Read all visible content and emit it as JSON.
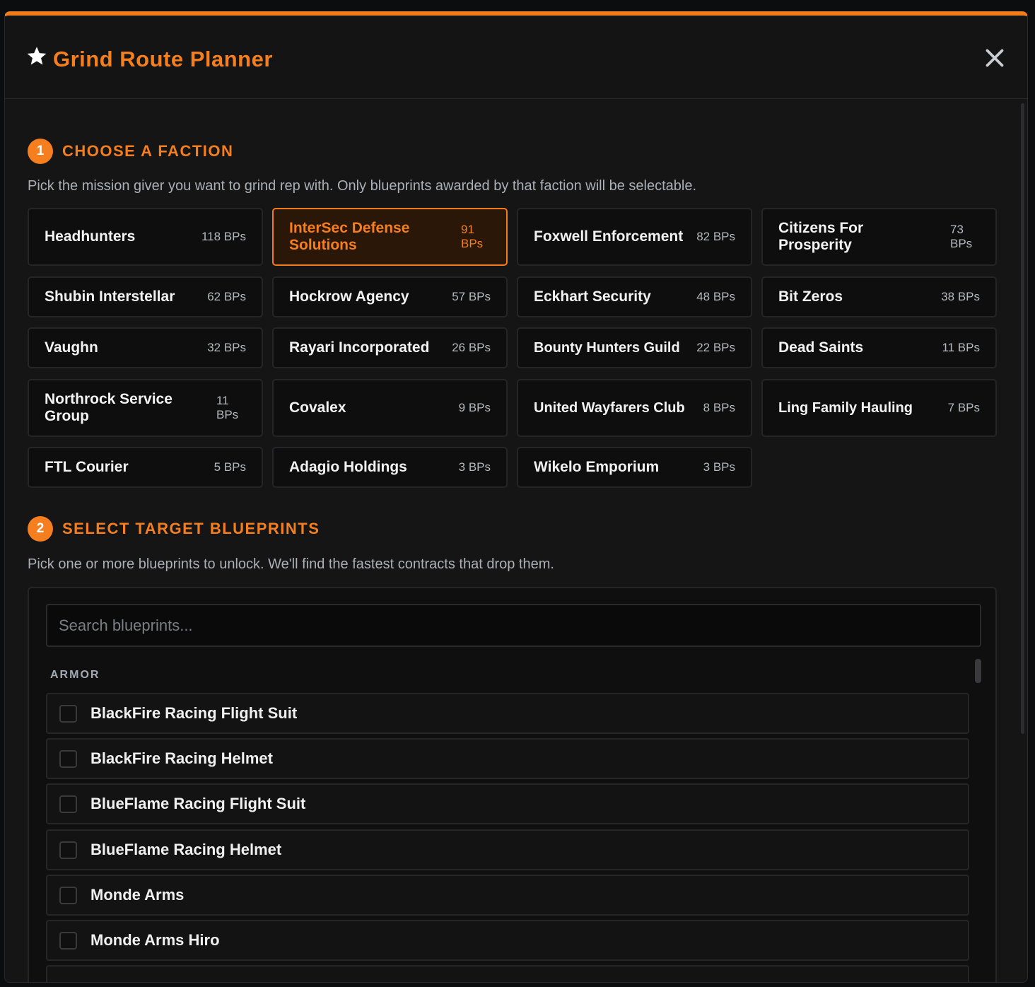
{
  "modal": {
    "title": "Grind Route Planner",
    "accent_color": "#f57f1f",
    "title_icon": "star-icon",
    "close_icon": "close-icon"
  },
  "step1": {
    "number": "1",
    "title": "CHOOSE A FACTION",
    "description": "Pick the mission giver you want to grind rep with. Only blueprints awarded by that faction will be selectable."
  },
  "factions": [
    {
      "name": "Headhunters",
      "count": "118 BPs",
      "selected": false
    },
    {
      "name": "InterSec Defense Solutions",
      "count": "91 BPs",
      "selected": true
    },
    {
      "name": "Foxwell Enforcement",
      "count": "82 BPs",
      "selected": false
    },
    {
      "name": "Citizens For Prosperity",
      "count": "73 BPs",
      "selected": false
    },
    {
      "name": "Shubin Interstellar",
      "count": "62 BPs",
      "selected": false
    },
    {
      "name": "Hockrow Agency",
      "count": "57 BPs",
      "selected": false
    },
    {
      "name": "Eckhart Security",
      "count": "48 BPs",
      "selected": false
    },
    {
      "name": "Bit Zeros",
      "count": "38 BPs",
      "selected": false
    },
    {
      "name": "Vaughn",
      "count": "32 BPs",
      "selected": false
    },
    {
      "name": "Rayari Incorporated",
      "count": "26 BPs",
      "selected": false
    },
    {
      "name": "Bounty Hunters Guild",
      "count": "22 BPs",
      "selected": false
    },
    {
      "name": "Dead Saints",
      "count": "11 BPs",
      "selected": false
    },
    {
      "name": "Northrock Service Group",
      "count": "11 BPs",
      "selected": false
    },
    {
      "name": "Covalex",
      "count": "9 BPs",
      "selected": false
    },
    {
      "name": "United Wayfarers Club",
      "count": "8 BPs",
      "selected": false
    },
    {
      "name": "Ling Family Hauling",
      "count": "7 BPs",
      "selected": false
    },
    {
      "name": "FTL Courier",
      "count": "5 BPs",
      "selected": false
    },
    {
      "name": "Adagio Holdings",
      "count": "3 BPs",
      "selected": false
    },
    {
      "name": "Wikelo Emporium",
      "count": "3 BPs",
      "selected": false
    }
  ],
  "step2": {
    "number": "2",
    "title": "SELECT TARGET BLUEPRINTS",
    "description": "Pick one or more blueprints to unlock. We'll find the fastest contracts that drop them."
  },
  "blueprints": {
    "search_placeholder": "Search blueprints...",
    "search_value": "",
    "group_label": "ARMOR",
    "items": [
      {
        "name": "BlackFire Racing Flight Suit",
        "checked": false
      },
      {
        "name": "BlackFire Racing Helmet",
        "checked": false
      },
      {
        "name": "BlueFlame Racing Flight Suit",
        "checked": false
      },
      {
        "name": "BlueFlame Racing Helmet",
        "checked": false
      },
      {
        "name": "Monde Arms",
        "checked": false
      },
      {
        "name": "Monde Arms Hiro",
        "checked": false
      }
    ]
  }
}
